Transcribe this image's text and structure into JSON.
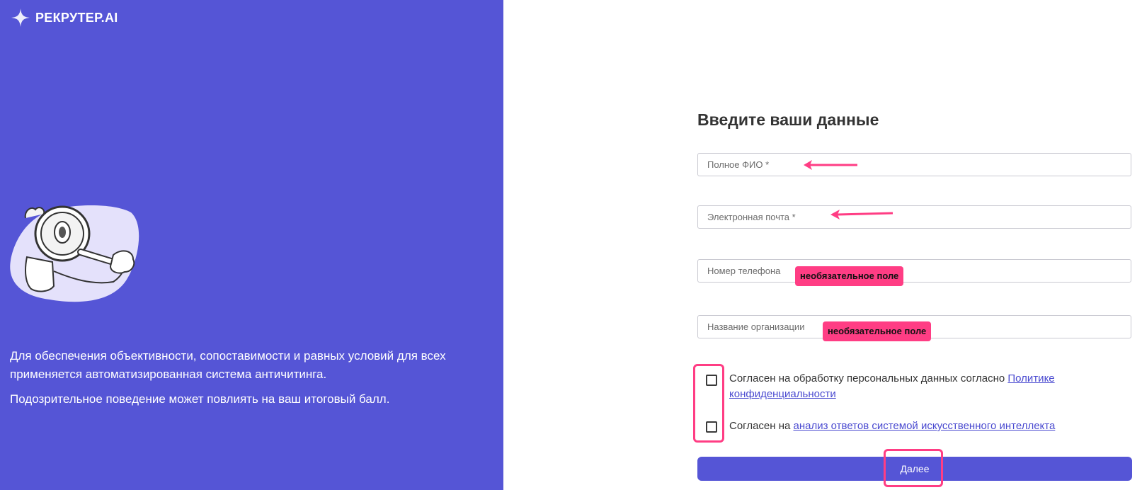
{
  "brand": {
    "name": "РЕКРУТЕР.AI",
    "logo_icon": "sparkle-icon"
  },
  "left_panel": {
    "background": "#5555d6",
    "mascot_icon": "magnifier-mascot-icon",
    "info_line_1": "Для обеспечения объективности, сопоставимости и равных условий для всех применяется автоматизированная система античитинга.",
    "info_line_2": "Подозрительное поведение может повлиять на ваш итоговый балл."
  },
  "form": {
    "title": "Введите ваши данные",
    "fields": [
      {
        "placeholder": "Полное ФИО *",
        "value": ""
      },
      {
        "placeholder": "Электронная почта *",
        "value": ""
      },
      {
        "placeholder": "Номер телефона",
        "value": ""
      },
      {
        "placeholder": "Название организации",
        "value": ""
      }
    ],
    "optional_tag": "необязательное поле",
    "consent_1_text": "Согласен на обработку персональных данных согласно ",
    "consent_1_link": "Политике конфиденциальности",
    "consent_2_text": "Согласен на ",
    "consent_2_link": "анализ ответов системой искусственного интеллекта",
    "submit_label": "Далее"
  },
  "annotation_color": "#ff3d84"
}
